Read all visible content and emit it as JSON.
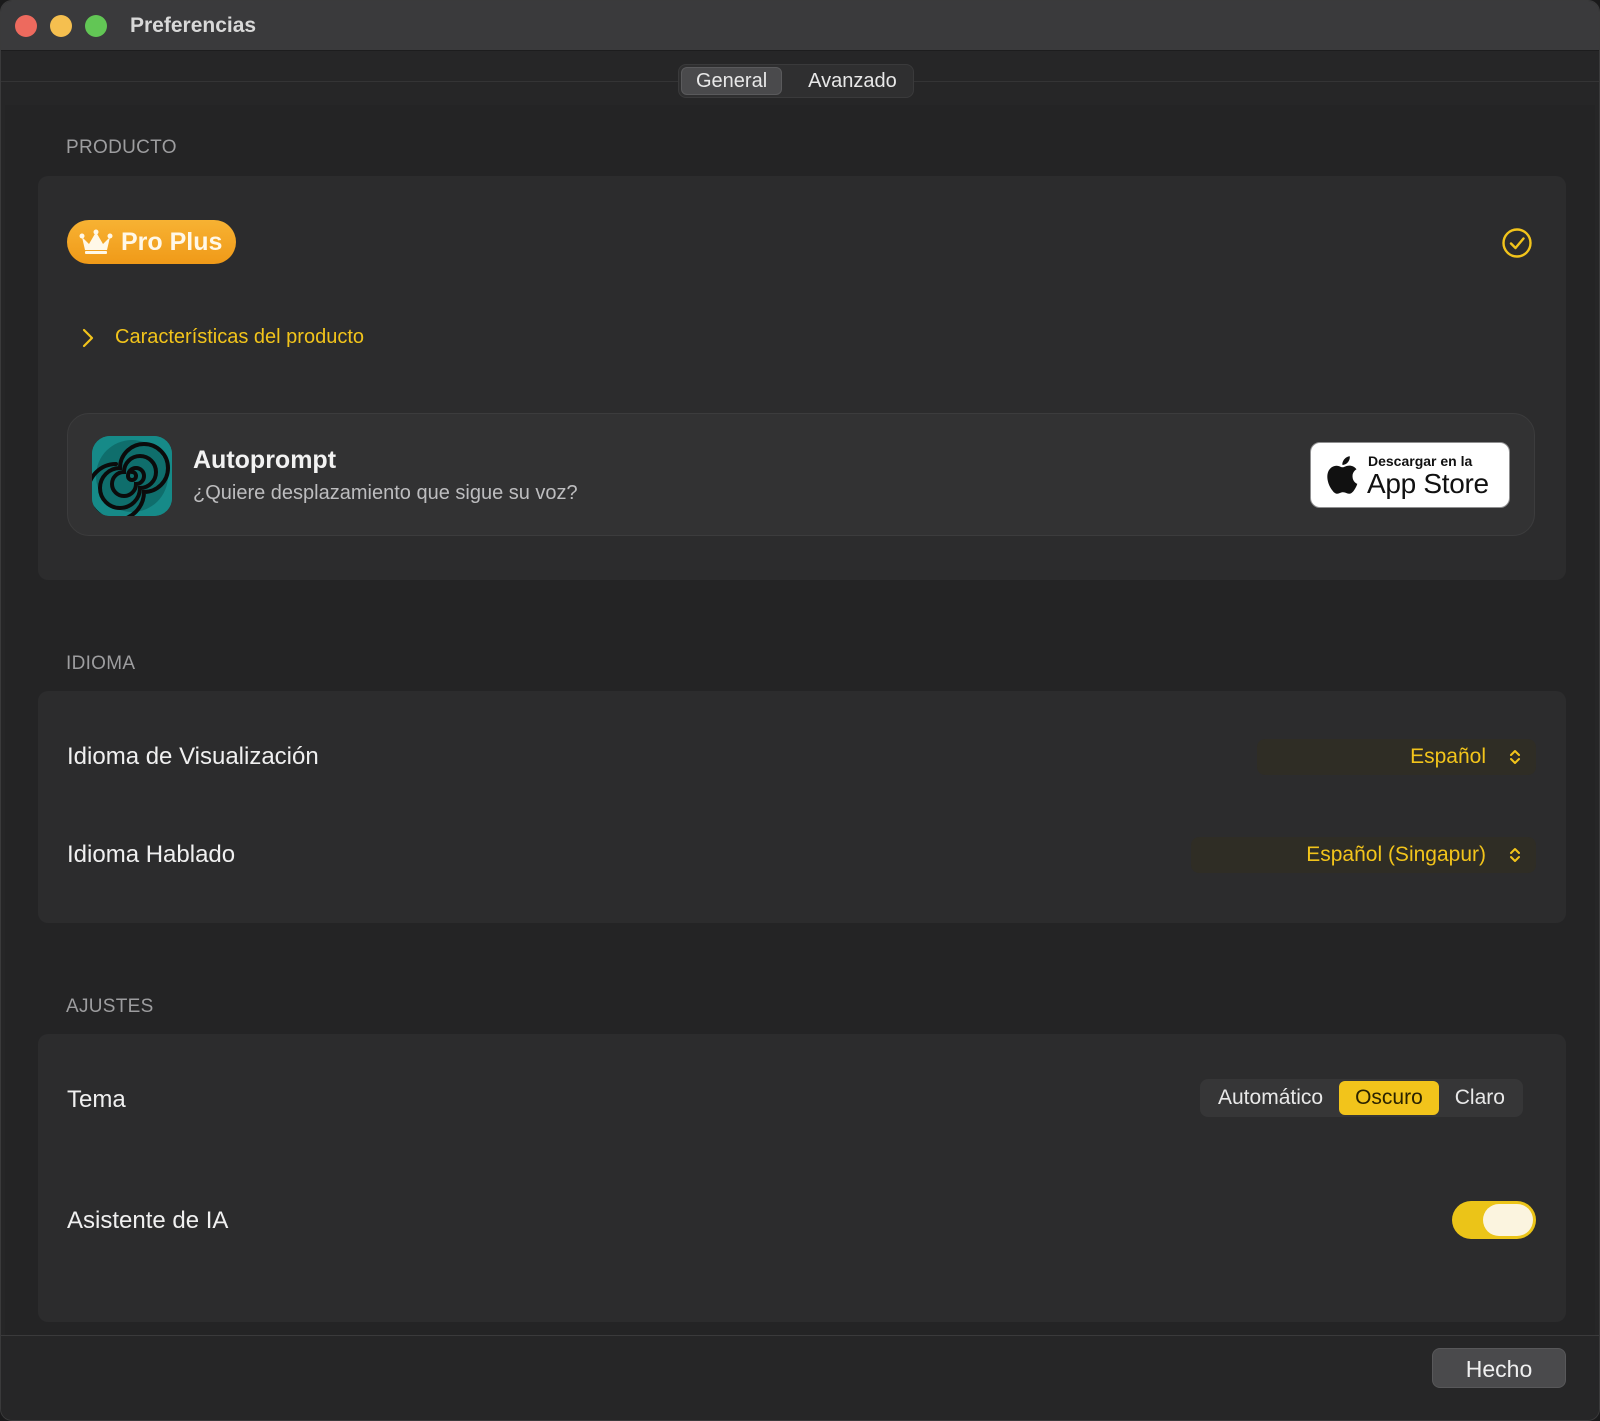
{
  "window": {
    "title": "Preferencias"
  },
  "tabs": [
    {
      "label": "General",
      "selected": true
    },
    {
      "label": "Avanzado",
      "selected": false
    }
  ],
  "product": {
    "section_label": "PRODUCTO",
    "badge_label": "Pro Plus",
    "features_label": "Características del producto",
    "promo": {
      "title": "Autoprompt",
      "subtitle": "¿Quiere desplazamiento que sigue su voz?",
      "store_small": "Descargar en la",
      "store_big": "App Store"
    }
  },
  "language": {
    "section_label": "IDIOMA",
    "display_label": "Idioma de Visualización",
    "display_value": "Español",
    "spoken_label": "Idioma Hablado",
    "spoken_value": "Español (Singapur)"
  },
  "settings": {
    "section_label": "AJUSTES",
    "theme_label": "Tema",
    "theme_options": [
      "Automático",
      "Oscuro",
      "Claro"
    ],
    "theme_selected": "Oscuro",
    "ai_label": "Asistente de IA",
    "ai_enabled": true
  },
  "footer": {
    "done_label": "Hecho"
  },
  "colors": {
    "accent": "#f2c41b",
    "badge": "#f5a623"
  },
  "icons": {
    "badge": "crown-icon",
    "status": "checkmark-circle-icon",
    "disclosure": "chevron-right-icon",
    "select": "up-down-chevron-icon",
    "store": "apple-logo-icon"
  }
}
